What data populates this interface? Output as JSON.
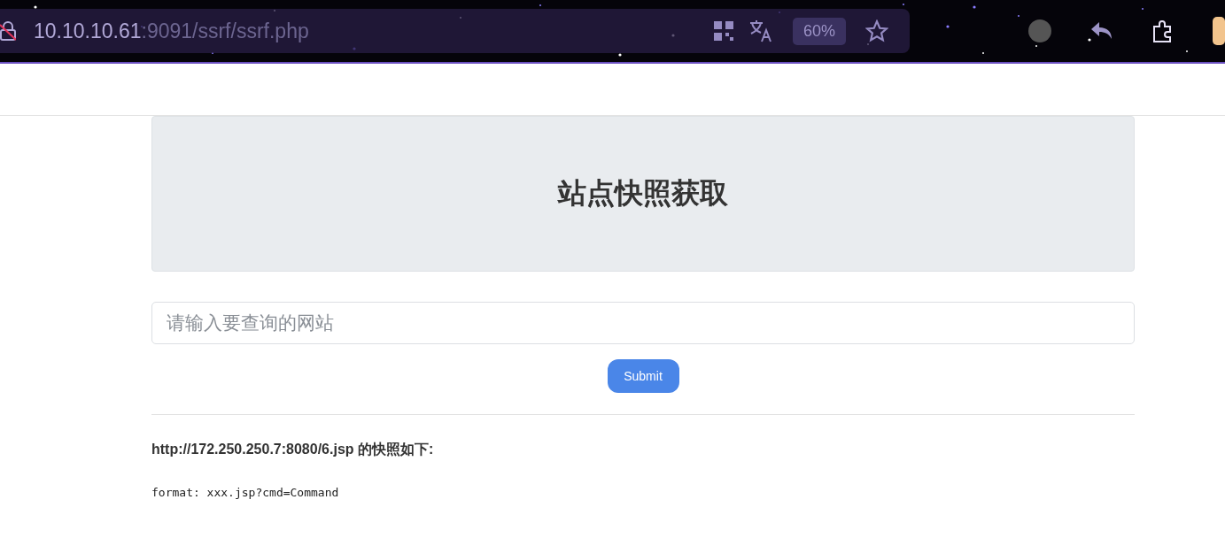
{
  "browser": {
    "address": {
      "host": "10.10.10.61",
      "path": ":9091/ssrf/ssrf.php"
    },
    "zoom": "60%"
  },
  "page": {
    "title": "站点快照获取",
    "search": {
      "placeholder": "请输入要查询的网站"
    },
    "submit": "Submit",
    "result": {
      "heading": "http://172.250.250.7:8080/6.jsp 的快照如下:",
      "output": "format: xxx.jsp?cmd=Command"
    }
  }
}
